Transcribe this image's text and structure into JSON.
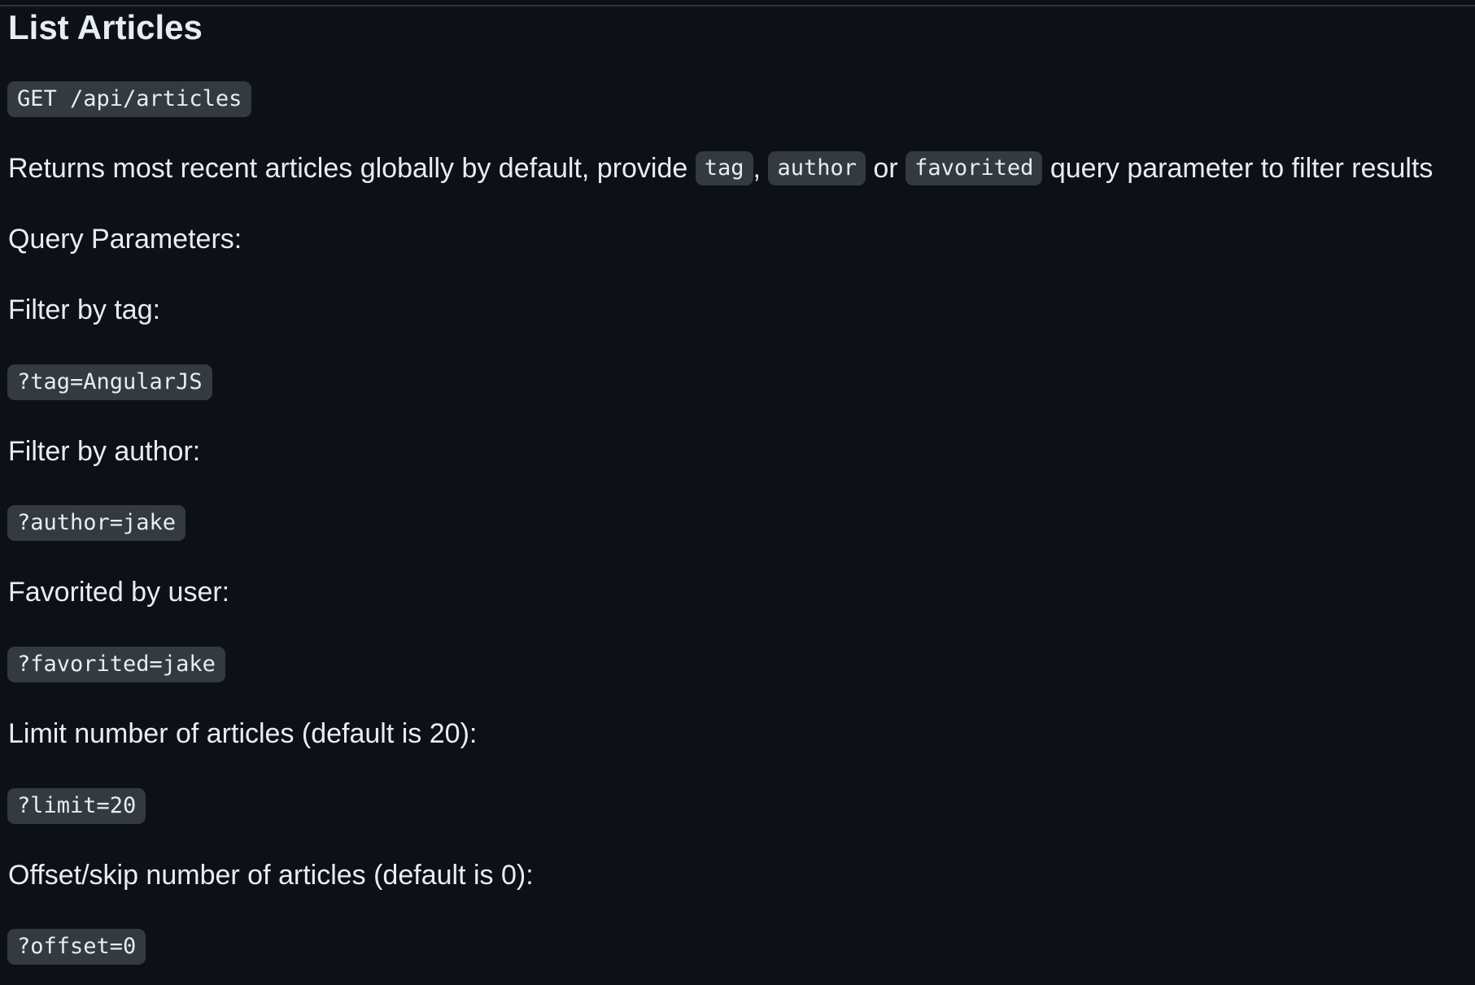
{
  "heading": "List Articles",
  "endpoint": "GET /api/articles",
  "description": {
    "prefix": "Returns most recent articles globally by default, provide ",
    "code_tag": "tag",
    "sep1": ", ",
    "code_author": "author",
    "sep2": " or ",
    "code_favorited": "favorited",
    "suffix": " query parameter to filter results"
  },
  "query_params_label": "Query Parameters:",
  "sections": [
    {
      "label": "Filter by tag:",
      "code": "?tag=AngularJS"
    },
    {
      "label": "Filter by author:",
      "code": "?author=jake"
    },
    {
      "label": "Favorited by user:",
      "code": "?favorited=jake"
    },
    {
      "label": "Limit number of articles (default is 20):",
      "code": "?limit=20"
    },
    {
      "label": "Offset/skip number of articles (default is 0):",
      "code": "?offset=0"
    }
  ],
  "colors": {
    "background": "#0d1117",
    "text": "#e6edf3",
    "code_background": "#343a41"
  }
}
